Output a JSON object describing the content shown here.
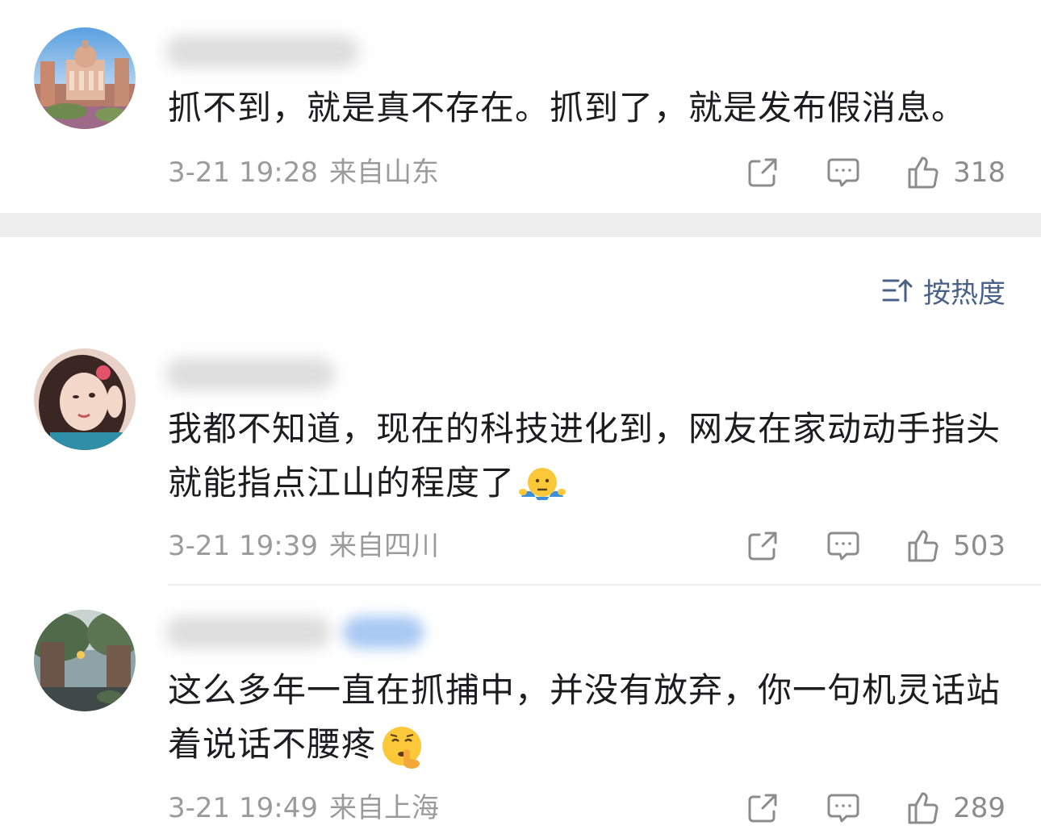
{
  "comments": [
    {
      "text": "抓不到，就是真不存在。抓到了，就是发布假消息。",
      "date": "3-21 19:28",
      "location": "来自山东",
      "likes": "318",
      "avatar_icon": "avatar-cityscape",
      "emoji": null
    },
    {
      "text": "我都不知道，现在的科技进化到，网友在家动动手指头就能指点江山的程度了",
      "date": "3-21 19:39",
      "location": "来自四川",
      "likes": "503",
      "avatar_icon": "avatar-portrait",
      "emoji": "shrug-emoji"
    },
    {
      "text": "这么多年一直在抓捕中，并没有放弃，你一句机灵话站着说话不腰疼",
      "date": "3-21 19:49",
      "location": "来自上海",
      "likes": "289",
      "avatar_icon": "avatar-street",
      "emoji": "shush-emoji"
    }
  ],
  "sort": {
    "label": "按热度",
    "icon": "sort-icon"
  },
  "icons": {
    "share": "share-icon",
    "comment": "comment-icon",
    "like": "thumbs-up-icon"
  },
  "colors": {
    "text": "#1d1d1f",
    "meta": "#9b9b9b",
    "sort": "#4a6187",
    "separator": "#eeeeee"
  }
}
